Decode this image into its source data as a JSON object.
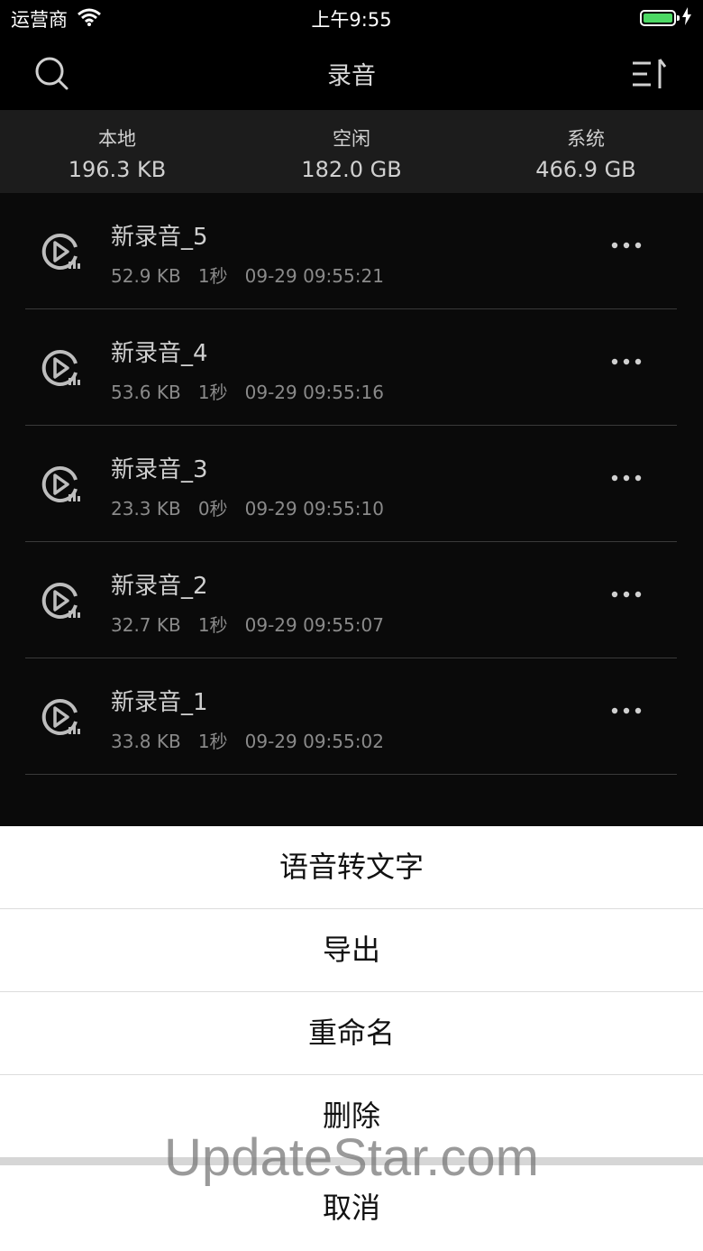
{
  "status_bar": {
    "carrier": "运营商",
    "time": "上午9:55",
    "battery_level": 1.0
  },
  "nav": {
    "title": "录音",
    "search_icon": "search-icon",
    "sort_icon": "sort-icon"
  },
  "storage": [
    {
      "label": "本地",
      "value": "196.3 KB"
    },
    {
      "label": "空闲",
      "value": "182.0 GB"
    },
    {
      "label": "系统",
      "value": "466.9 GB"
    }
  ],
  "recordings": [
    {
      "title": "新录音_5",
      "size": "52.9 KB",
      "duration": "1秒",
      "date": "09-29 09:55:21"
    },
    {
      "title": "新录音_4",
      "size": "53.6 KB",
      "duration": "1秒",
      "date": "09-29 09:55:16"
    },
    {
      "title": "新录音_3",
      "size": "23.3 KB",
      "duration": "0秒",
      "date": "09-29 09:55:10"
    },
    {
      "title": "新录音_2",
      "size": "32.7 KB",
      "duration": "1秒",
      "date": "09-29 09:55:07"
    },
    {
      "title": "新录音_1",
      "size": "33.8 KB",
      "duration": "1秒",
      "date": "09-29 09:55:02"
    }
  ],
  "action_sheet": {
    "items": [
      "语音转文字",
      "导出",
      "重命名",
      "删除"
    ],
    "cancel": "取消"
  },
  "watermark": "UpdateStar.com",
  "colors": {
    "battery": "#4cd964",
    "storage_bg": "#1c1c1c"
  }
}
